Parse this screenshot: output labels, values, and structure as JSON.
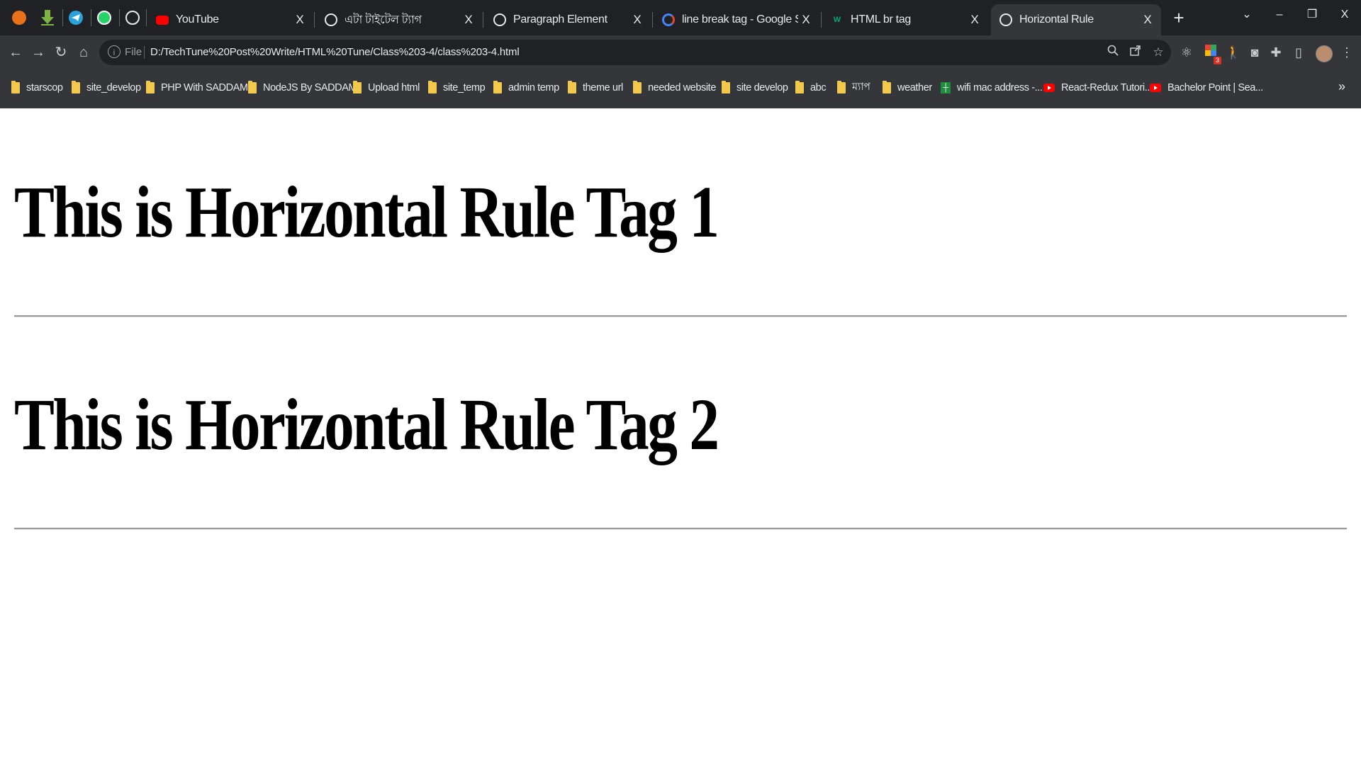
{
  "browser": {
    "pinned_tabs": [
      {
        "icon": "firefox-like-extension-icon",
        "color": "#e8711a"
      },
      {
        "icon": "download-icon",
        "color": "#7cb342"
      },
      {
        "icon": "telegram-icon",
        "color": "#2aa1da"
      },
      {
        "icon": "whatsapp-icon",
        "color": "#25d366"
      },
      {
        "icon": "globe-icon",
        "color": "#e8eaed"
      }
    ],
    "tabs": [
      {
        "label": "YouTube",
        "icon": "youtube-icon",
        "close": "X",
        "active": false
      },
      {
        "label": "এটা টাইটেল ট্যাগ",
        "icon": "globe-icon",
        "close": "X",
        "active": false
      },
      {
        "label": "Paragraph Element",
        "icon": "globe-icon",
        "close": "X",
        "active": false
      },
      {
        "label": "line break tag - Google Search",
        "icon": "google-icon",
        "close": "X",
        "active": false
      },
      {
        "label": "HTML br tag",
        "icon": "w3schools-icon",
        "close": "X",
        "active": false
      },
      {
        "label": "Horizontal Rule",
        "icon": "globe-icon",
        "close": "X",
        "active": true
      }
    ],
    "new_tab": "+",
    "window_controls": {
      "tab_search": "⌄",
      "minimize": "–",
      "restore": "❐",
      "close": "X"
    },
    "toolbar": {
      "back": "←",
      "forward": "→",
      "reload": "↻",
      "home": "⌂",
      "site_info_icon": "i",
      "scheme_label": "File",
      "url": "D:/TechTune%20Post%20Write/HTML%20Tune/Class%203-4/class%203-4.html",
      "extension_badge": "3"
    },
    "bookmarks": [
      {
        "label": "starscop",
        "icon": "folder"
      },
      {
        "label": "site_develop",
        "icon": "folder"
      },
      {
        "label": "PHP With SADDAM",
        "icon": "folder"
      },
      {
        "label": "NodeJS By SADDAM",
        "icon": "folder"
      },
      {
        "label": "Upload html",
        "icon": "folder"
      },
      {
        "label": "site_temp",
        "icon": "folder"
      },
      {
        "label": "admin temp",
        "icon": "folder"
      },
      {
        "label": "theme url",
        "icon": "folder"
      },
      {
        "label": "needed website",
        "icon": "folder"
      },
      {
        "label": "site develop",
        "icon": "folder"
      },
      {
        "label": "abc",
        "icon": "folder"
      },
      {
        "label": "ম্যাপ",
        "icon": "folder"
      },
      {
        "label": "weather",
        "icon": "folder"
      },
      {
        "label": "wifi mac address -...",
        "icon": "green-bookmark"
      },
      {
        "label": "React-Redux Tutori...",
        "icon": "youtube"
      },
      {
        "label": "Bachelor Point | Sea...",
        "icon": "youtube"
      }
    ],
    "bookmarks_more": "»"
  },
  "page": {
    "heading_1": "This is Horizontal Rule Tag 1",
    "heading_2": "This is Horizontal Rule Tag 2"
  },
  "colors": {
    "tabstrip": "#202124",
    "toolbar": "#35363a",
    "text_light": "#e8eaed",
    "rule": "#9a9a9a"
  }
}
